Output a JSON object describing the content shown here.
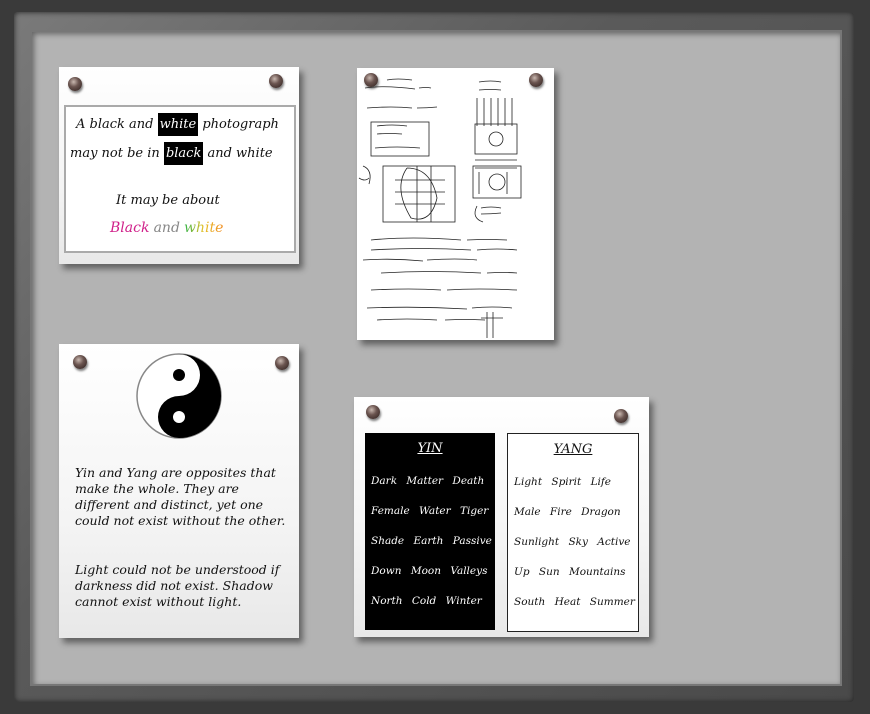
{
  "note1": {
    "line1": {
      "before": "A black and",
      "highlight": "white",
      "after": "photograph"
    },
    "line2": {
      "before": "may not be in",
      "highlight": "black",
      "after": "and white"
    },
    "line3": "It may be  about",
    "line4": {
      "w1": "Black",
      "w2": "and",
      "w3": "white"
    }
  },
  "note3": {
    "para1": "Yin and Yang are opposites that make the whole. They are different and distinct, yet one could not exist without the other.",
    "para2": "Light could not be understood if darkness did not exist. Shadow cannot exist without light."
  },
  "note4": {
    "yin": {
      "title": "YIN",
      "rows": [
        "Dark   Matter   Death",
        "Female  Water  Tiger",
        "Shade  Earth  Passive",
        "Down   Moon   Valleys",
        "North   Cold    Winter"
      ]
    },
    "yang": {
      "title": "YANG",
      "rows": [
        "Light   Spirit   Life",
        "Male   Fire  Dragon",
        "Sunlight Sky Active",
        "Up  Sun  Mountains",
        "South  Heat  Summer"
      ]
    }
  },
  "colors": {
    "board": "#b3b3b3",
    "frame": "#5a5a5a",
    "note": "#ffffff"
  }
}
